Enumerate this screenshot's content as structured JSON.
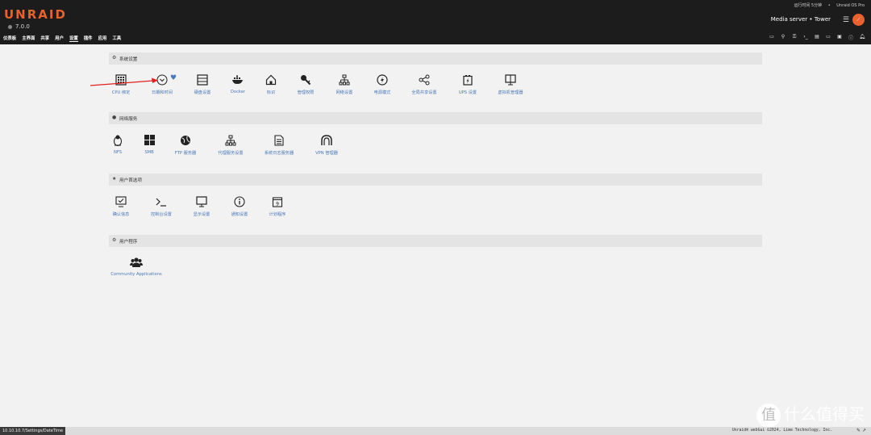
{
  "header": {
    "logo": "UNRAID",
    "version": "7.0.0",
    "uptime": "运行时间 5分钟",
    "edition": "Unraid OS Pro",
    "server": "Media server • Tower"
  },
  "nav": [
    "仪表板",
    "主界面",
    "共享",
    "用户",
    "设置",
    "插件",
    "应用",
    "工具"
  ],
  "sections": {
    "system": {
      "title": "系统设置",
      "items": [
        "CPU 绑定",
        "日期和时间",
        "硬盘设置",
        "Docker",
        "标识",
        "管理权限",
        "网络设置",
        "电源模式",
        "全局共享设置",
        "UPS 设置",
        "虚拟机管理器"
      ]
    },
    "network": {
      "title": "网络服务",
      "items": [
        "NFS",
        "SMB",
        "FTP 服务器",
        "代理服务设置",
        "系统日志服务器",
        "VPN 管理器"
      ]
    },
    "user": {
      "title": "用户首选项",
      "items": [
        "确认信息",
        "控制台设置",
        "显示设置",
        "通知设置",
        "计划程序"
      ]
    },
    "apps": {
      "title": "用户程序",
      "items": [
        "Community Applications"
      ]
    }
  },
  "footer": {
    "status_url": "10.10.10.7/Settings/DateTime",
    "copyright": "Unraid® webGui ©2024, Lime Technology, Inc."
  },
  "watermark": "什么值得买",
  "colors": {
    "accent": "#e8612e",
    "link": "#4a78b8",
    "header_bg": "#1c1c1c",
    "arrow": "#e02020"
  }
}
